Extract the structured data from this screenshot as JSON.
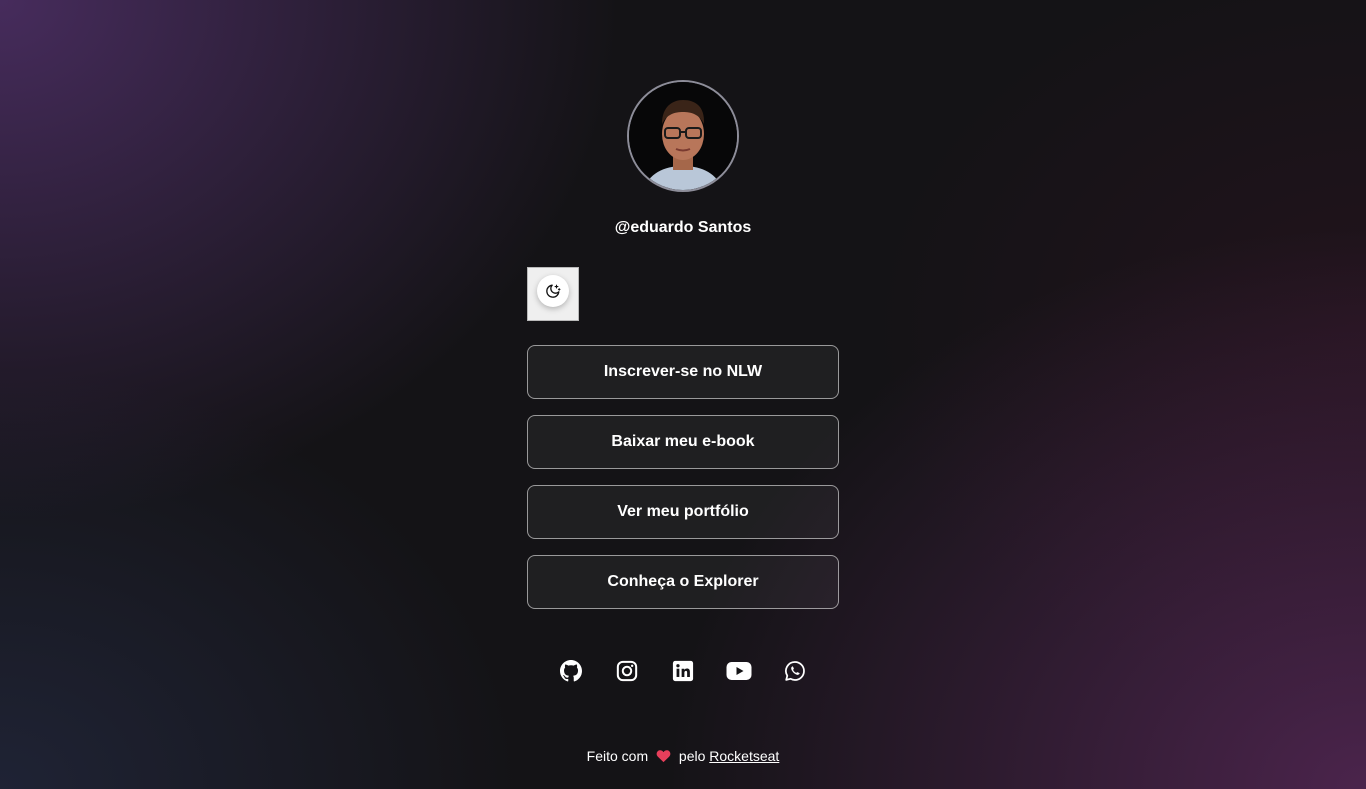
{
  "profile": {
    "username": "@eduardo Santos",
    "avatar_alt": "avatar"
  },
  "theme_switch": {
    "icon": "moon-stars-icon"
  },
  "links": [
    {
      "label": "Inscrever-se no NLW"
    },
    {
      "label": "Baixar meu e-book"
    },
    {
      "label": "Ver meu portfólio"
    },
    {
      "label": "Conheça o Explorer"
    }
  ],
  "social": [
    {
      "icon": "github-icon"
    },
    {
      "icon": "instagram-icon"
    },
    {
      "icon": "linkedin-icon"
    },
    {
      "icon": "youtube-icon"
    },
    {
      "icon": "whatsapp-icon"
    }
  ],
  "footer": {
    "prefix": "Feito com",
    "heart_icon": "heart-icon",
    "middle": "pelo",
    "link_label": "Rocketseat"
  },
  "colors": {
    "text": "#ffffff",
    "border": "#8d8d99",
    "heart": "#e83f5b"
  }
}
